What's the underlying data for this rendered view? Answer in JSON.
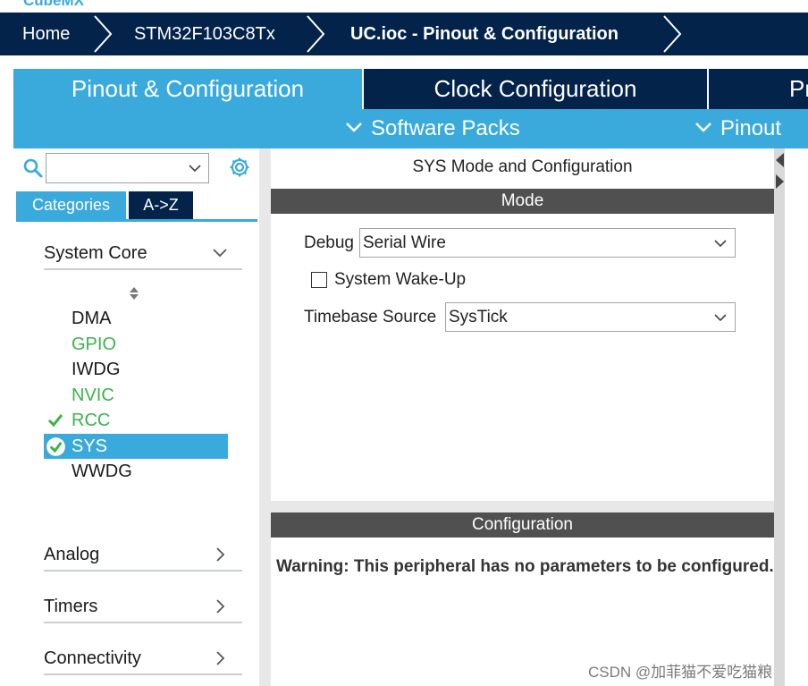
{
  "app": {
    "logo_text": "CubeMX"
  },
  "breadcrumb": [
    {
      "label": "Home"
    },
    {
      "label": "STM32F103C8Tx"
    },
    {
      "label": "UC.ioc - Pinout & Configuration"
    }
  ],
  "main_tabs": [
    {
      "label": "Pinout & Configuration",
      "active": true
    },
    {
      "label": "Clock Configuration",
      "active": false
    },
    {
      "label": "Pr",
      "active": false
    }
  ],
  "sub_menu": [
    {
      "label": "Software Packs"
    },
    {
      "label": "Pinout"
    }
  ],
  "left_panel": {
    "search": {
      "value": "",
      "placeholder": ""
    },
    "category_tabs": [
      {
        "label": "Categories",
        "active": true
      },
      {
        "label": "A->Z",
        "active": false
      }
    ],
    "groups": [
      {
        "label": "System Core",
        "expanded": true,
        "items": [
          {
            "label": "DMA",
            "state": "default"
          },
          {
            "label": "GPIO",
            "state": "configured"
          },
          {
            "label": "IWDG",
            "state": "default"
          },
          {
            "label": "NVIC",
            "state": "configured"
          },
          {
            "label": "RCC",
            "state": "checked"
          },
          {
            "label": "SYS",
            "state": "selected"
          },
          {
            "label": "WWDG",
            "state": "default"
          }
        ]
      },
      {
        "label": "Analog",
        "expanded": false
      },
      {
        "label": "Timers",
        "expanded": false
      },
      {
        "label": "Connectivity",
        "expanded": false
      }
    ]
  },
  "right_panel": {
    "title": "SYS Mode and Configuration",
    "mode_header": "Mode",
    "debug": {
      "label": "Debug",
      "value": "Serial Wire"
    },
    "wakeup": {
      "label": "System Wake-Up",
      "checked": false
    },
    "timebase": {
      "label": "Timebase Source",
      "value": "SysTick"
    },
    "config_header": "Configuration",
    "warning": "Warning: This peripheral has no parameters to be configured."
  },
  "watermark": "CSDN @加菲猫不爱吃猫粮",
  "colors": {
    "navy": "#03234b",
    "accent": "#3aaadc",
    "green": "#3ab54a",
    "band": "#505050"
  }
}
